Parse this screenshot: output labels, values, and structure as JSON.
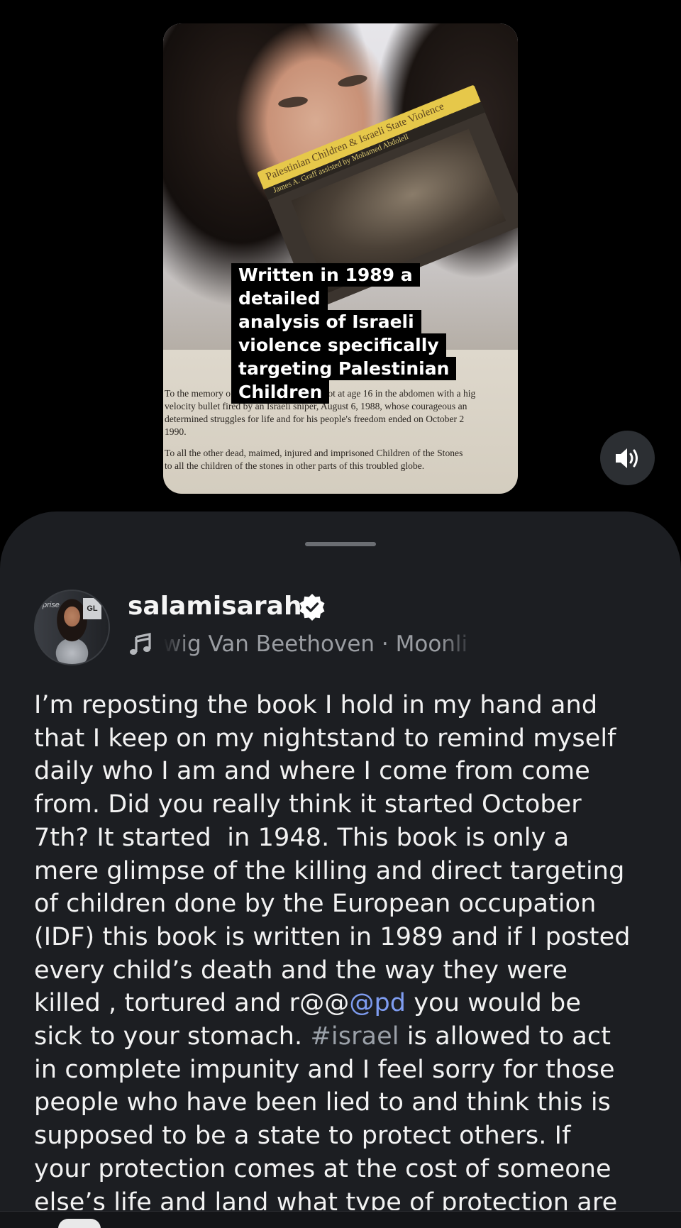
{
  "post_media": {
    "book_title": "Palestinian Children & Israeli State Violence",
    "book_subtitle": "James A. Graff assisted by Mohamed Abdolell",
    "caption_lines": [
      "Written in 1989 a detailed",
      "analysis of Israeli",
      "violence specifically",
      "targeting Palestinian",
      "Children"
    ],
    "page_paragraph_1": [
      "To the memory of Mohamed Abu Aker, shot at age 16 in the abdomen with a hig",
      "velocity bullet fired by an Israeli sniper, August 6, 1988, whose courageous an",
      "determined struggles for life and for his people's freedom ended on October 2",
      "1990."
    ],
    "page_paragraph_2": [
      "To all the other dead, maimed, injured and imprisoned Children of the Stones",
      "to all the children of the stones in other parts of this troubled globe."
    ],
    "sound_icon": "speaker-on-icon"
  },
  "profile": {
    "username": "salamisarah",
    "verified_icon": "verified-badge-icon",
    "avatar_logo_left": "prise",
    "avatar_logo_right": "GL",
    "music_icon": "music-note-icon",
    "music_text": "wig Van Beethoven · Moonli"
  },
  "description": {
    "lines": [
      [
        "I’m reposting the book I hold in my hand and"
      ],
      [
        "that I keep on my nightstand to remind myself"
      ],
      [
        "daily who I am and where I come from come"
      ],
      [
        "from. Did you really think it started October"
      ],
      [
        "7th? It started  in 1948. This book is only a"
      ],
      [
        "mere glimpse of the killing and direct targeting"
      ],
      [
        "of children done by the European occupation"
      ],
      [
        "(IDF) this book is written in 1989 and if I posted"
      ],
      [
        "every child’s death and the way they were"
      ],
      [
        "killed , tortured and r@@",
        "@pd",
        " you would be"
      ],
      [
        "sick to your stomach. ",
        "#israel",
        " is allowed to act"
      ],
      [
        "in complete impunity and I feel sorry for those"
      ],
      [
        "people who have been lied to and think this is"
      ],
      [
        "supposed to be a state to protect others. If"
      ],
      [
        "your protection comes at the cost of someone"
      ],
      [
        "else’s life and land what type of protection are"
      ]
    ],
    "mention_color": "#7e9cf0",
    "hashtag_color": "#9aa0a8"
  }
}
